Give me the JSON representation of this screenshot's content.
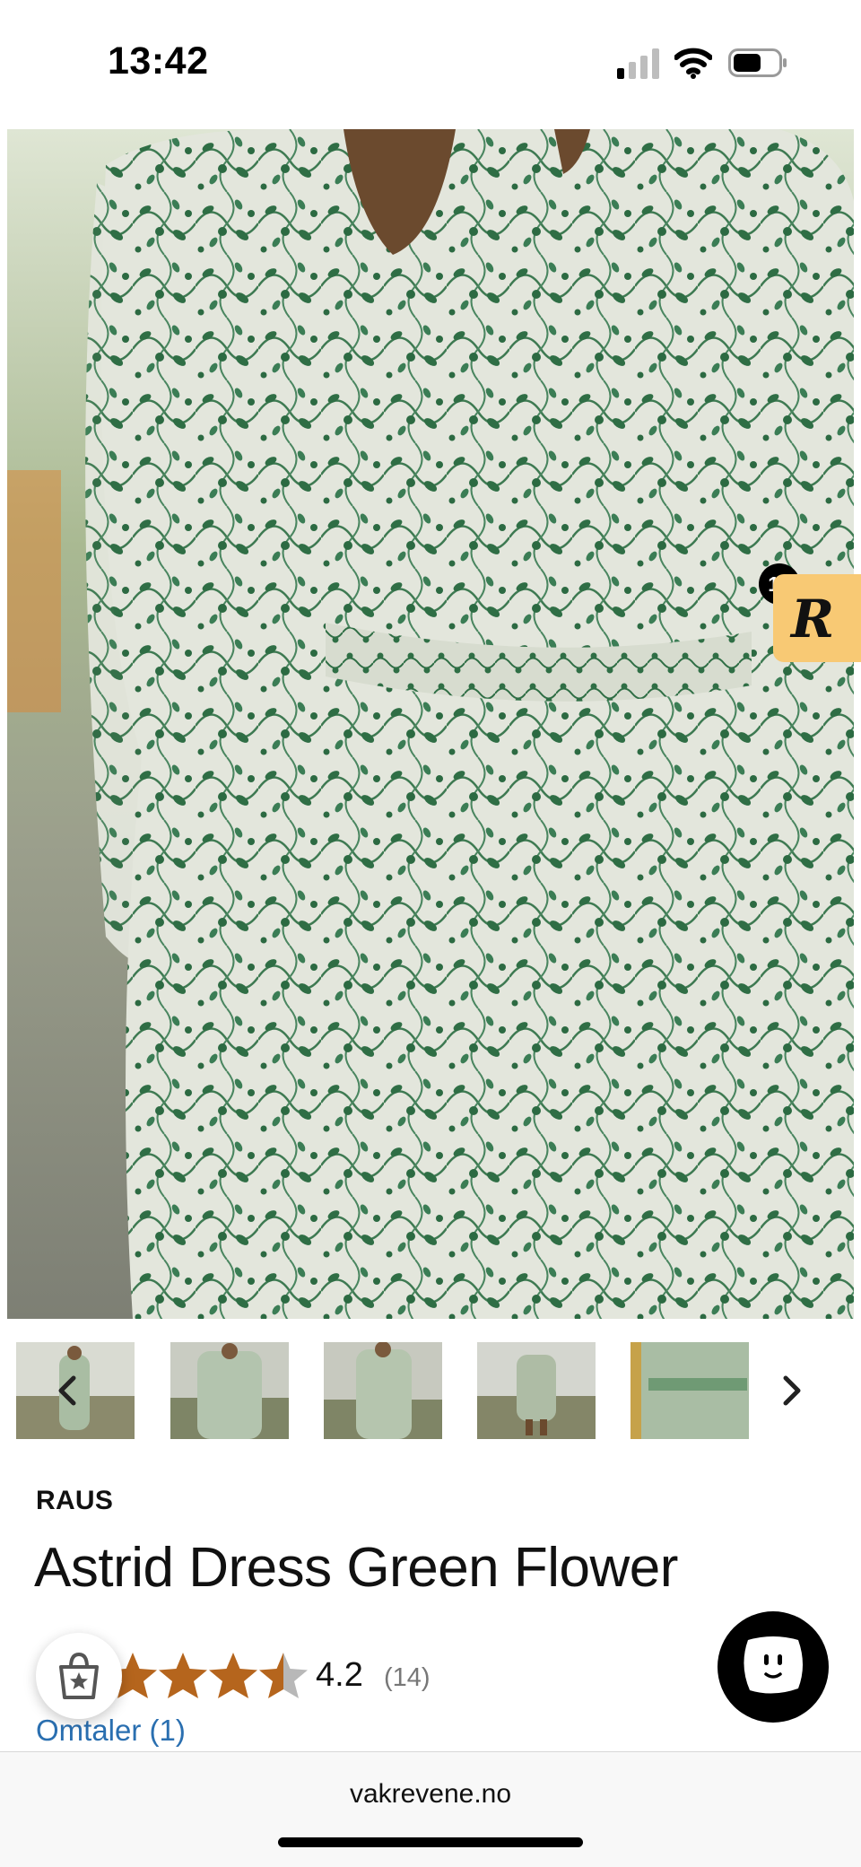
{
  "status_bar": {
    "time": "13:42"
  },
  "rewards_badge": {
    "count": "10",
    "letter": "R"
  },
  "product": {
    "brand": "RAUS",
    "title": "Astrid Dress Green Flower",
    "rating": 4.2,
    "rating_value": "4.2",
    "rating_count": "(14)",
    "reviews_link": "Omtaler (1)"
  },
  "thumbnails": {
    "count_visible": 5
  },
  "browser": {
    "url": "vakrevene.no"
  },
  "colors": {
    "star": "#b5651d",
    "star_empty": "#b8b8b8",
    "link": "#2a6fb0",
    "badge": "#f8c974",
    "dress_green": "#2f6e45",
    "dress_base": "#e6e8e0"
  }
}
